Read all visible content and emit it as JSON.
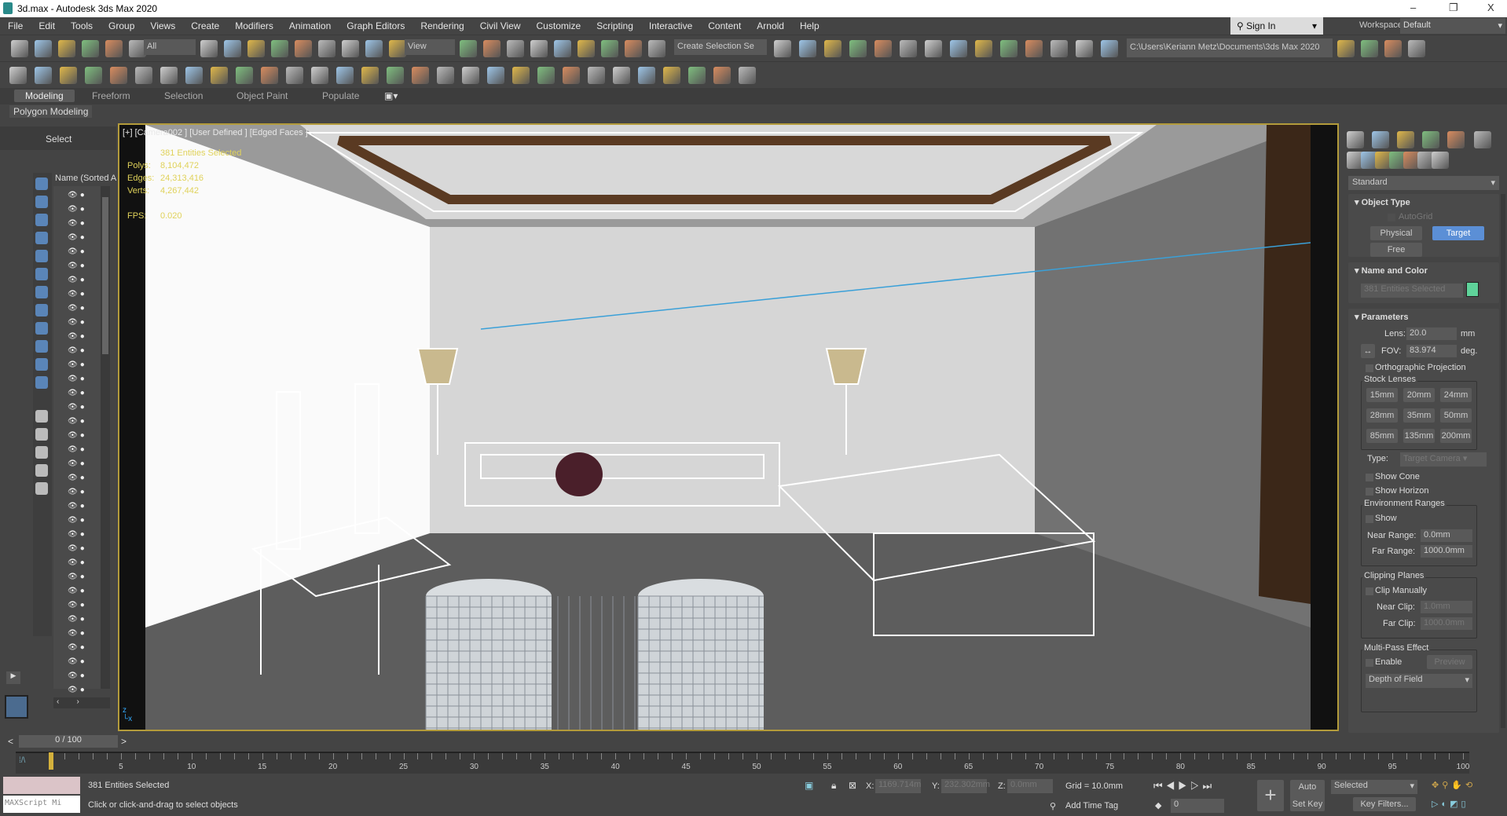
{
  "window": {
    "title": "3d.max - Autodesk 3ds Max 2020",
    "minimize": "–",
    "restore": "❐",
    "close": "X"
  },
  "menu": [
    "File",
    "Edit",
    "Tools",
    "Group",
    "Views",
    "Create",
    "Modifiers",
    "Animation",
    "Graph Editors",
    "Rendering",
    "Civil View",
    "Customize",
    "Scripting",
    "Interactive",
    "Content",
    "Arnold",
    "Help"
  ],
  "signin": "Sign In",
  "workspaces_label": "Workspaces:",
  "workspace": "Default",
  "toolbar": {
    "filter": "All",
    "refcoord": "View",
    "selection_set": "Create Selection Se",
    "project_path": "C:\\Users\\Keriann Metz\\Documents\\3ds Max 2020"
  },
  "ribbon": {
    "tabs": [
      "Modeling",
      "Freeform",
      "Selection",
      "Object Paint",
      "Populate"
    ],
    "active": "Modeling",
    "panel": "Polygon Modeling"
  },
  "scene_explorer": {
    "title": "Select",
    "column": "Name (Sorted A"
  },
  "viewport": {
    "label": "[+] [Camera002 ] [User Defined ] [Edged Faces ]",
    "selected": "381 Entities Selected",
    "polys_label": "Polys:",
    "polys": "8,104,472",
    "edges_label": "Edges:",
    "edges": "24,313,416",
    "verts_label": "Verts:",
    "verts": "4,267,442",
    "fps_label": "FPS:",
    "fps": "0.020"
  },
  "command_panel": {
    "category": "Standard",
    "object_type": {
      "title": "Object Type",
      "autogrid": "AutoGrid",
      "buttons": [
        "Physical",
        "Target",
        "Free"
      ],
      "active": "Target"
    },
    "name_color": {
      "title": "Name and Color",
      "name": "381 Entities Selected",
      "color": "#5fd39a"
    },
    "parameters": {
      "title": "Parameters",
      "lens_label": "Lens:",
      "lens": "20.0",
      "lens_unit": "mm",
      "fov_label": "FOV:",
      "fov": "83.974",
      "fov_unit": "deg.",
      "ortho": "Orthographic Projection",
      "stock_lenses": "Stock Lenses",
      "lenses": [
        "15mm",
        "20mm",
        "24mm",
        "28mm",
        "35mm",
        "50mm",
        "85mm",
        "135mm",
        "200mm"
      ],
      "type_label": "Type:",
      "type": "Target Camera",
      "show_cone": "Show Cone",
      "show_horizon": "Show Horizon",
      "env_ranges": "Environment Ranges",
      "show": "Show",
      "near_range_label": "Near Range:",
      "near_range": "0.0mm",
      "far_range_label": "Far Range:",
      "far_range": "1000.0mm",
      "clipping": "Clipping Planes",
      "clip_manually": "Clip Manually",
      "near_clip_label": "Near Clip:",
      "near_clip": "1.0mm",
      "far_clip_label": "Far Clip:",
      "far_clip": "1000.0mm",
      "multipass": "Multi-Pass Effect",
      "enable": "Enable",
      "preview": "Preview",
      "effect": "Depth of Field"
    }
  },
  "timeline": {
    "slider": "0 / 100",
    "prev": "<",
    "next": ">",
    "ticks": [
      "5",
      "10",
      "15",
      "20",
      "25",
      "30",
      "35",
      "40",
      "45",
      "50",
      "55",
      "60",
      "65",
      "70",
      "75",
      "80",
      "85",
      "90",
      "95",
      "100"
    ]
  },
  "status": {
    "maxscript": "MAXScript Mi",
    "selected": "381 Entities Selected",
    "prompt": "Click or click-and-drag to select objects",
    "x_label": "X:",
    "x": "1169.714m",
    "y_label": "Y:",
    "y": "232.302mm",
    "z_label": "Z:",
    "z": "0.0mm",
    "grid": "Grid = 10.0mm",
    "add_time_tag": "Add Time Tag",
    "auto_key": "Auto Key",
    "set_key": "Set Key",
    "key_mode": "Selected",
    "frame": "0",
    "key_filters": "Key Filters..."
  },
  "colors": {
    "accent": "#5b8fd6",
    "viewport_border": "#b39b3b",
    "stats": "#e0d25a"
  }
}
